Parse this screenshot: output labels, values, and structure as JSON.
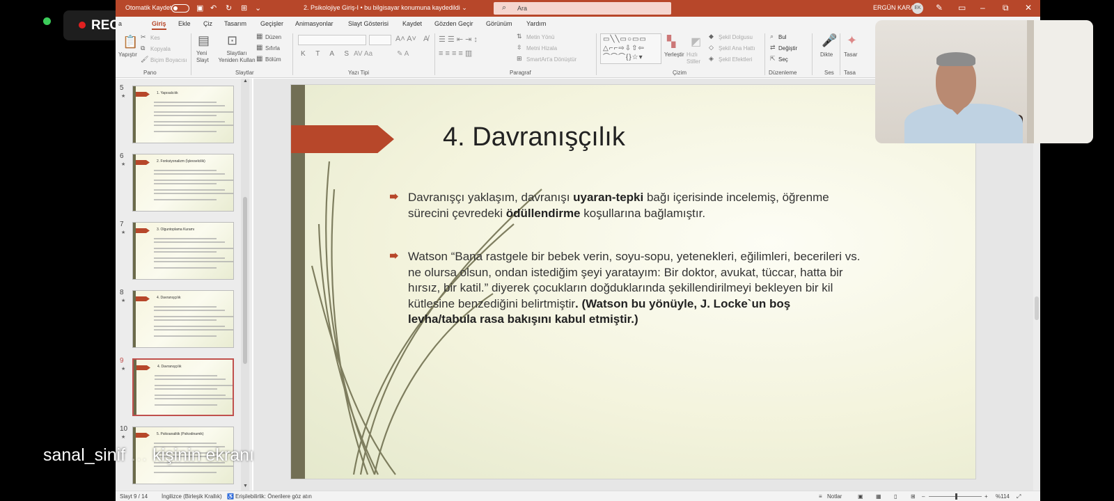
{
  "recording": {
    "label": "REC"
  },
  "titlebar": {
    "autosave_label": "Otomatik Kaydet",
    "document_title": "2. Psikolojiye Giriş-I  •  bu bilgisayar konumuna kaydedildi ⌄",
    "search_placeholder": "Ara",
    "user_name": "ERGÜN KARA",
    "user_initials": "EK"
  },
  "tabs": [
    "a",
    "Giriş",
    "Ekle",
    "Çiz",
    "Tasarım",
    "Geçişler",
    "Animasyonlar",
    "Slayt Gösterisi",
    "Kaydet",
    "Gözden Geçir",
    "Görünüm",
    "Yardım"
  ],
  "ribbon": {
    "pano": {
      "label": "Pano",
      "paste": "Yapıştır",
      "cut": "Kes",
      "copy": "Kopyala",
      "format_painter": "Biçim Boyacısı"
    },
    "slaytlar": {
      "label": "Slaytlar",
      "new_slide": "Yeni Slayt",
      "reuse": "Slaytları Yeniden Kullan",
      "layout": "Düzen",
      "reset": "Sıfırla",
      "section": "Bölüm"
    },
    "yazi_tipi": {
      "label": "Yazı Tipi"
    },
    "paragraf": {
      "label": "Paragraf",
      "text_direction": "Metin Yönü",
      "align_text": "Metni Hizala",
      "smartart": "SmartArt'a Dönüştür"
    },
    "cizim": {
      "label": "Çizim",
      "arrange": "Yerleştir",
      "quick_styles": "Hızlı Stiller",
      "shape_fill": "Şekil Dolgusu",
      "shape_outline": "Şekil Ana Hattı",
      "shape_effects": "Şekil Efektleri"
    },
    "duzenleme": {
      "label": "Düzenleme",
      "find": "Bul",
      "replace": "Değiştir",
      "select": "Seç"
    },
    "ses": {
      "label": "Ses",
      "dictate": "Dikte"
    },
    "tasarim": {
      "label": "Tasa",
      "designer": "Tasar"
    }
  },
  "thumbnails": [
    {
      "num": "5",
      "title": "1. Yapısalcılık"
    },
    {
      "num": "6",
      "title": "2. Fonksiyonalizm (İşlevselcilik)"
    },
    {
      "num": "7",
      "title": "3. Olguntoplama Kuramı"
    },
    {
      "num": "8",
      "title": "4. Davranışçılık"
    },
    {
      "num": "9",
      "title": "4. Davranışçılık"
    },
    {
      "num": "10",
      "title": "5. Psikoanalitik (Psikodinamik)"
    }
  ],
  "slide": {
    "title": "4. Davranışçılık",
    "b1": {
      "t1": "Davranışçı yaklaşım, davranışı ",
      "bold1": "uyaran-tepki",
      "t2": " bağı içerisinde incelemiş, öğrenme sürecini çevredeki ",
      "bold2": "ödüllendirme",
      "t3": " koşullarına bağlamıştır."
    },
    "b2": {
      "t1": "Watson “Bana rastgele bir bebek verin, soyu-sopu, yetenekleri, eğilimleri, becerileri vs. ne olursa olsun, ondan istediğim şeyi yaratayım: Bir doktor, avukat, tüccar, hatta bir hırsız, bir katil.” diyerek çocukların doğduklarında şekillendirilmeyi bekleyen bir kil kütlesine benzediğini belirtmiştir",
      "bold": ". (Watson bu yönüyle, J. Locke`un boş levha/tabula rasa bakışını kabul etmiştir.)"
    }
  },
  "statusbar": {
    "slide_counter": "Slayt 9 / 14",
    "language": "İngilizce (Birleşik Krallık)",
    "accessibility": "Erişilebilirlik: Önerilere göz atın",
    "notes": "Notlar",
    "zoom": "%114"
  },
  "caption": {
    "name": "sanal_sinif",
    "suffix": "kişinin ekranı"
  }
}
